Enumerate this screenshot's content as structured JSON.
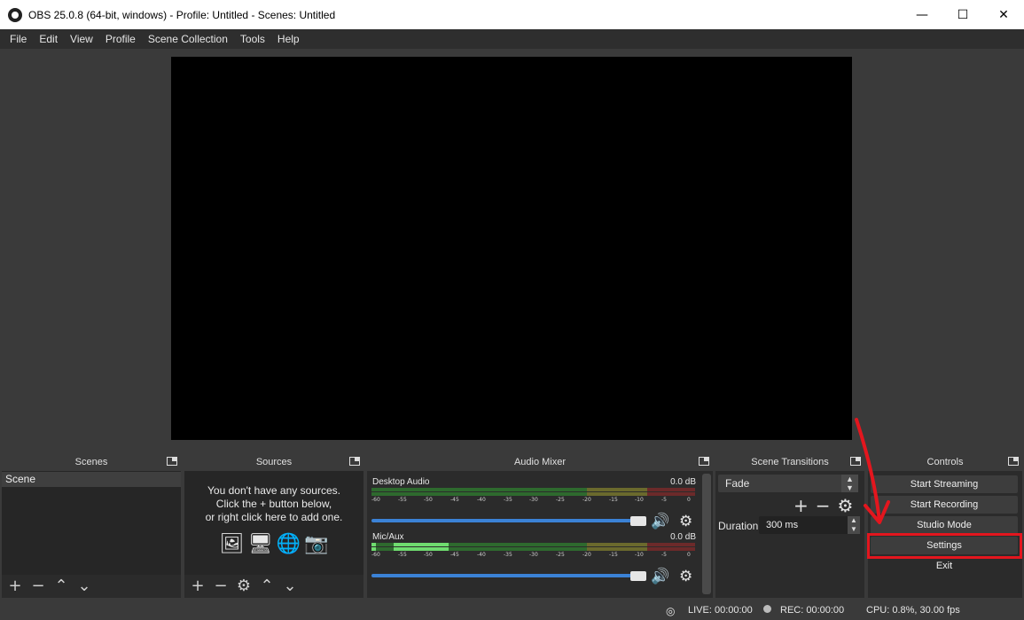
{
  "window": {
    "title": "OBS 25.0.8 (64-bit, windows) - Profile: Untitled - Scenes: Untitled",
    "controls": [
      "minimize",
      "maximize",
      "close"
    ]
  },
  "menu": [
    "File",
    "Edit",
    "View",
    "Profile",
    "Scene Collection",
    "Tools",
    "Help"
  ],
  "docks": {
    "scenes": {
      "title": "Scenes",
      "items": [
        "Scene"
      ]
    },
    "sources": {
      "title": "Sources",
      "empty_line1": "You don't have any sources.",
      "empty_line2": "Click the + button below,",
      "empty_line3": "or right click here to add one.",
      "icons": [
        "image-icon",
        "display-icon",
        "browser-icon",
        "camera-icon"
      ]
    },
    "mixer": {
      "title": "Audio Mixer",
      "channels": [
        {
          "name": "Desktop Audio",
          "db": "0.0 dB"
        },
        {
          "name": "Mic/Aux",
          "db": "0.0 dB"
        }
      ],
      "ticks": [
        "-60",
        "-55",
        "-50",
        "-45",
        "-40",
        "-35",
        "-30",
        "-25",
        "-20",
        "-15",
        "-10",
        "-5",
        "0"
      ]
    },
    "transitions": {
      "title": "Scene Transitions",
      "selected": "Fade",
      "duration_label": "Duration",
      "duration_value": "300 ms"
    },
    "controls": {
      "title": "Controls",
      "buttons": [
        "Start Streaming",
        "Start Recording",
        "Studio Mode",
        "Settings",
        "Exit"
      ],
      "highlighted": "Settings"
    }
  },
  "status": {
    "live": "LIVE: 00:00:00",
    "rec": "REC: 00:00:00",
    "cpu": "CPU: 0.8%, 30.00 fps"
  },
  "colors": {
    "annotation": "#e3161e",
    "volume_slider": "#3b82d6",
    "meter_green": "#2e6a2e",
    "meter_yellow": "#6b6a2d",
    "meter_red": "#6c2a2a"
  }
}
